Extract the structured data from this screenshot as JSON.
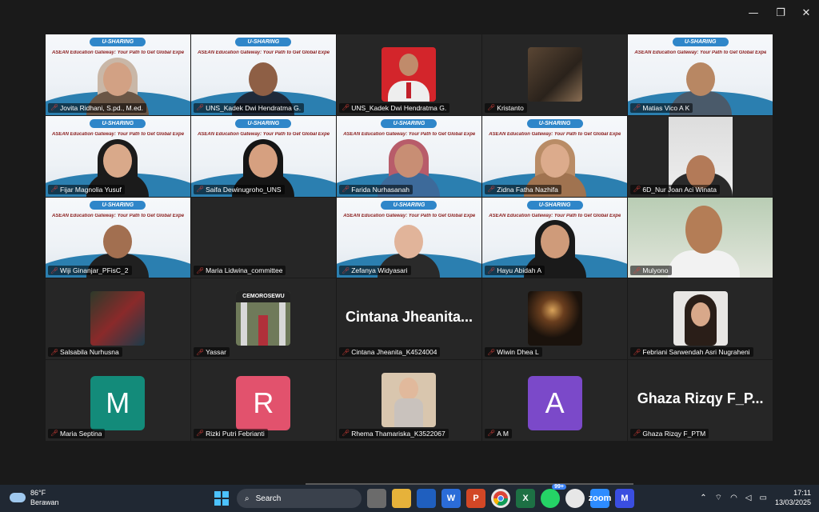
{
  "window": {
    "minimize": "—",
    "restore": "❐",
    "close": "✕"
  },
  "slide": {
    "banner": "U-SHARING",
    "subtitle": "ASEAN Education Gateway: Your Path to Get Global Experiences"
  },
  "participants": [
    {
      "name": "Jovita Ridhani, S.pd., M.ed.",
      "kind": "slide",
      "skin": "#d2a184",
      "hijab": "#c9b7a7",
      "body": "#6a5646"
    },
    {
      "name": "UNS_Kadek Dwi Hendratma G.",
      "kind": "slide",
      "skin": "#8e5f45",
      "hijab": "",
      "body": "#1f2a3a"
    },
    {
      "name": "UNS_Kadek Dwi Hendratma G.",
      "kind": "photo-red"
    },
    {
      "name": "Kristanto",
      "kind": "photo-dark"
    },
    {
      "name": "Matias Vico A K",
      "kind": "slide",
      "skin": "#b88763",
      "hijab": "",
      "body": "#4a5a6a",
      "active": true
    },
    {
      "name": "Fijar Magnolia Yusuf",
      "kind": "slide",
      "skin": "#d9a98a",
      "hijab": "#1b1b1b",
      "body": "#1b1b1b"
    },
    {
      "name": "Saifa Dewinugroho_UNS",
      "kind": "slide",
      "skin": "#d6a080",
      "hijab": "#151515",
      "body": "#151515"
    },
    {
      "name": "Farida Nurhasanah",
      "kind": "slide",
      "skin": "#c88e74",
      "hijab": "#b85c6a",
      "body": "#3d6a9a"
    },
    {
      "name": "Zidna Fatha Nazhifa",
      "kind": "slide",
      "skin": "#dcab8c",
      "hijab": "#b98c66",
      "body": "#a07350"
    },
    {
      "name": "6D_Nur Joan Aci Winata",
      "kind": "cam-room"
    },
    {
      "name": "Wiji Ginanjar_PFisC_2",
      "kind": "slide",
      "skin": "#a26f50",
      "hijab": "",
      "body": "#202020"
    },
    {
      "name": "Maria Lidwina_committee",
      "kind": "empty"
    },
    {
      "name": "Zefanya Widyasari",
      "kind": "slide",
      "skin": "#e1b49a",
      "hijab": "",
      "body": "#2a2a2a"
    },
    {
      "name": "Hayu Abidah A",
      "kind": "slide",
      "skin": "#cf9b7a",
      "hijab": "#1a1a1a",
      "body": "#1a1a1a"
    },
    {
      "name": "Mulyono",
      "kind": "cam-green"
    },
    {
      "name": "Salsabila Nurhusna",
      "kind": "avatar-anime"
    },
    {
      "name": "Yassar",
      "kind": "avatar-gate",
      "sign": "CEMOROSEWU"
    },
    {
      "name": "Cintana Jheanita_K4524004",
      "kind": "big-name",
      "display": "Cintana Jheanita..."
    },
    {
      "name": "Wiwin Dhea L",
      "kind": "avatar-night"
    },
    {
      "name": "Febriani Sarwendah Asri Nugraheni",
      "kind": "avatar-girl"
    },
    {
      "name": "Maria Septina",
      "kind": "letter",
      "letter": "M",
      "color": "#138b7a"
    },
    {
      "name": "Rizki Putri Febrianti",
      "kind": "letter",
      "letter": "R",
      "color": "#e2526d"
    },
    {
      "name": "Rhema Thamariska_K3522067",
      "kind": "avatar-portrait"
    },
    {
      "name": "A M",
      "kind": "letter",
      "letter": "A",
      "color": "#7b49c9"
    },
    {
      "name": "Ghaza Rizqy F_PTM",
      "kind": "big-name",
      "display": "Ghaza Rizqy F_P..."
    }
  ],
  "taskbar": {
    "weather_temp": "86°F",
    "weather_desc": "Berawan",
    "search_label": "Search",
    "badge_count": "99+",
    "time": "17:11",
    "date": "13/03/2025"
  }
}
